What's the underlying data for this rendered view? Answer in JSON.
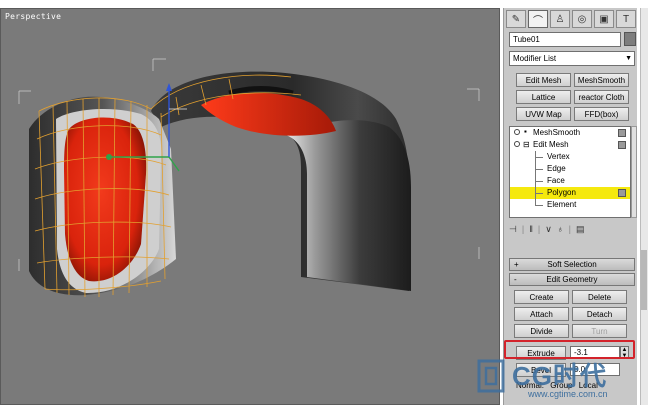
{
  "viewport": {
    "label": "Perspective"
  },
  "command_panel": {
    "tabs": [
      {
        "icon": "create-icon"
      },
      {
        "icon": "modify-icon"
      },
      {
        "icon": "hierarchy-icon"
      },
      {
        "icon": "motion-icon"
      },
      {
        "icon": "display-icon"
      },
      {
        "icon": "utilities-icon"
      }
    ],
    "active_tab": 1,
    "object_name": "Tube01",
    "object_color": "#7d7d7d",
    "modifier_list": "Modifier List",
    "modifier_buttons": [
      "Edit Mesh",
      "MeshSmooth",
      "Lattice",
      "reactor Cloth",
      "UVW Map",
      "FFD(box)"
    ],
    "stack": [
      {
        "label": "MeshSmooth",
        "level": 0
      },
      {
        "label": "Edit Mesh",
        "level": 0
      },
      {
        "label": "Vertex",
        "level": 1
      },
      {
        "label": "Edge",
        "level": 1
      },
      {
        "label": "Face",
        "level": 1
      },
      {
        "label": "Polygon",
        "level": 1,
        "selected": true
      },
      {
        "label": "Element",
        "level": 1
      }
    ],
    "stack_toolbar": [
      "pin-stack-icon",
      "show-end-result-icon",
      "make-unique-icon",
      "remove-modifier-icon",
      "configure-sets-icon"
    ],
    "rollouts": {
      "soft_selection": {
        "sign": "+",
        "title": "Soft Selection"
      },
      "edit_geometry": {
        "sign": "-",
        "title": "Edit Geometry"
      }
    },
    "geometry_buttons": [
      {
        "label": "Create",
        "enabled": true
      },
      {
        "label": "Delete",
        "enabled": true
      },
      {
        "label": "Attach",
        "enabled": true
      },
      {
        "label": "Detach",
        "enabled": true
      },
      {
        "label": "Divide",
        "enabled": true
      },
      {
        "label": "Turn",
        "enabled": false
      }
    ],
    "extrude": {
      "label": "Extrude",
      "value": "-3.1"
    },
    "bevel": {
      "label": "Bevel",
      "value": "0.0"
    },
    "normal": {
      "label": "Normal:",
      "group": "Group",
      "local": "Local"
    }
  },
  "watermark": {
    "logo": "cgtime-logo",
    "brand": "CG时代",
    "url": "www.cgtime.com.cn"
  },
  "colors": {
    "viewport_bg": "#7a7a7a",
    "highlight": "#d3232b",
    "selection": "#f5e90e",
    "surface_red": "#e22410",
    "wire": "#e2a030"
  }
}
